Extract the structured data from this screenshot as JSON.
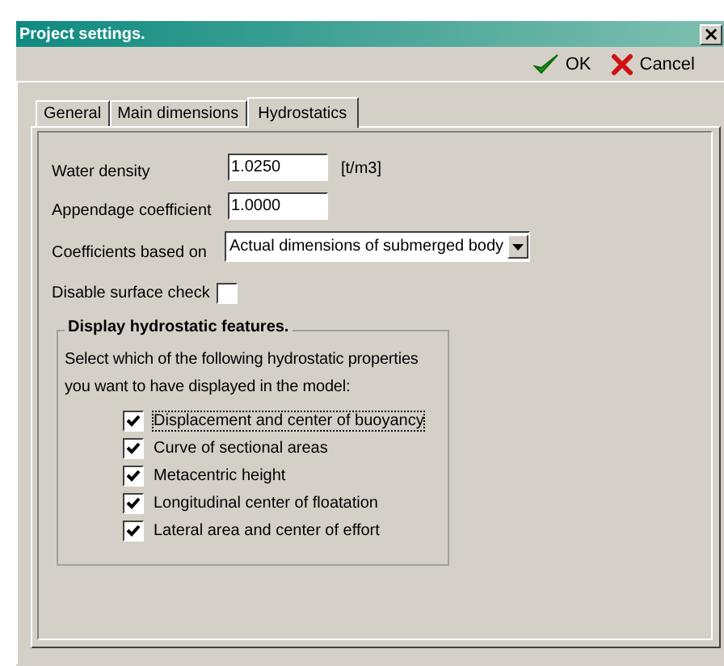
{
  "window": {
    "title": "Project settings.",
    "close": "×"
  },
  "toolbar": {
    "ok": "OK",
    "cancel": "Cancel"
  },
  "tabs": [
    {
      "label": "General",
      "selected": false
    },
    {
      "label": "Main dimensions",
      "selected": false
    },
    {
      "label": "Hydrostatics",
      "selected": true
    }
  ],
  "fields": [
    {
      "label": "Water density",
      "value": "1.0250",
      "unit": "[t/m3]"
    },
    {
      "label": "Appendage coefficient",
      "value": "1.0000"
    }
  ],
  "coefficients": {
    "label": "Coefficients based on",
    "value": "Actual dimensions of submerged body"
  },
  "surface_check": {
    "label": "Disable surface check",
    "checked": false
  },
  "group": {
    "title": "Display hydrostatic features.",
    "description": "Select which of the following hydrostatic properties you want to have displayed in the model:",
    "items": [
      {
        "label": "Displacement and center of buoyancy",
        "checked": true,
        "focused": true
      },
      {
        "label": "Curve of sectional areas",
        "checked": true,
        "focused": false
      },
      {
        "label": "Metacentric height",
        "checked": true,
        "focused": false
      },
      {
        "label": "Longitudinal center of floatation",
        "checked": true,
        "focused": false
      },
      {
        "label": "Lateral area and center of effort",
        "checked": true,
        "focused": false
      }
    ]
  }
}
